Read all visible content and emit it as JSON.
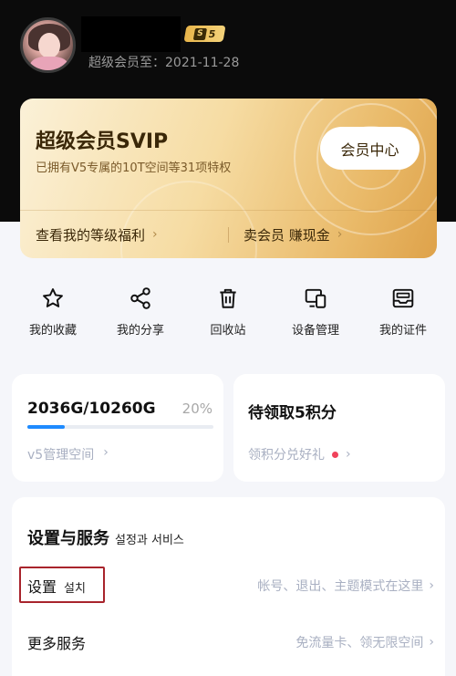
{
  "profile": {
    "member_until": "超级会员至：2021-11-28",
    "badge_letter": "S",
    "badge_level": "5"
  },
  "svip": {
    "title": "超级会员SVIP",
    "desc": "已拥有V5专属的10T空间等31项特权",
    "member_center": "会员中心",
    "link_benefits": "查看我的等级福利",
    "link_sell": "卖会员 赚现金"
  },
  "shortcuts": [
    {
      "label": "我的收藏",
      "icon": "star-icon"
    },
    {
      "label": "我的分享",
      "icon": "share-icon"
    },
    {
      "label": "回收站",
      "icon": "trash-icon"
    },
    {
      "label": "设备管理",
      "icon": "devices-icon"
    },
    {
      "label": "我的证件",
      "icon": "id-card-icon"
    }
  ],
  "storage": {
    "used": "2036G/10260G",
    "percent": "20%",
    "fill_fraction": 0.2,
    "link": "v5管理空间"
  },
  "points": {
    "title": "待领取5积分",
    "link": "领积分兑好礼"
  },
  "settings": {
    "title": "设置与服务",
    "title_sub": "설정과 서비스",
    "rows": [
      {
        "label": "设置",
        "label_sub": "설치",
        "hint": "帐号、退出、主题模式在这里"
      },
      {
        "label": "更多服务",
        "hint": "免流量卡、领无限空间"
      }
    ]
  },
  "colors": {
    "accent": "#1e8bff",
    "dot": "#f0425b",
    "highlight": "#a8242c"
  }
}
